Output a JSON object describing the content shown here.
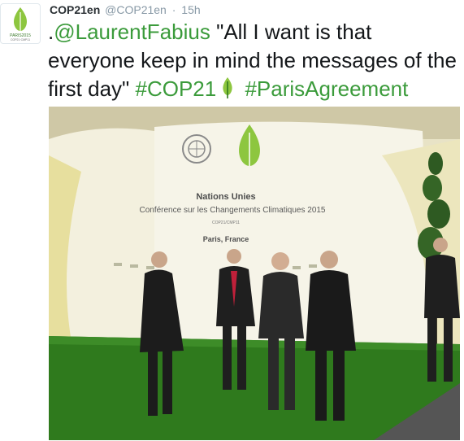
{
  "tweet": {
    "author_name": "COP21en",
    "author_handle": "@COP21en",
    "separator": "·",
    "timestamp": "15h",
    "text_prefix": ".",
    "mention": "@LaurentFabius",
    "quote": " \"All I want is that everyone keep in mind the messages of the first day\" ",
    "hashtag_1": "#COP21",
    "hashtag_2": "#ParisAgreement"
  },
  "avatar": {
    "icon": "cop21-leaf-logo-icon",
    "logo_text_line1": "PARIS2015",
    "logo_text_line2": "COP21·CMP11"
  },
  "photo": {
    "backdrop_line1": "Nations Unies",
    "backdrop_line2": "Conférence sur les Changements Climatiques 2015",
    "backdrop_line3": "COP21/CMP11",
    "backdrop_line4": "Paris, France",
    "un_emblem_icon": "un-emblem-icon",
    "leaf_logo_icon": "cop21-leaf-logo-icon"
  },
  "colors": {
    "hashtag": "#3b9b3b",
    "leaf_green": "#8dc63f",
    "turf_green": "#2f7a1d"
  }
}
